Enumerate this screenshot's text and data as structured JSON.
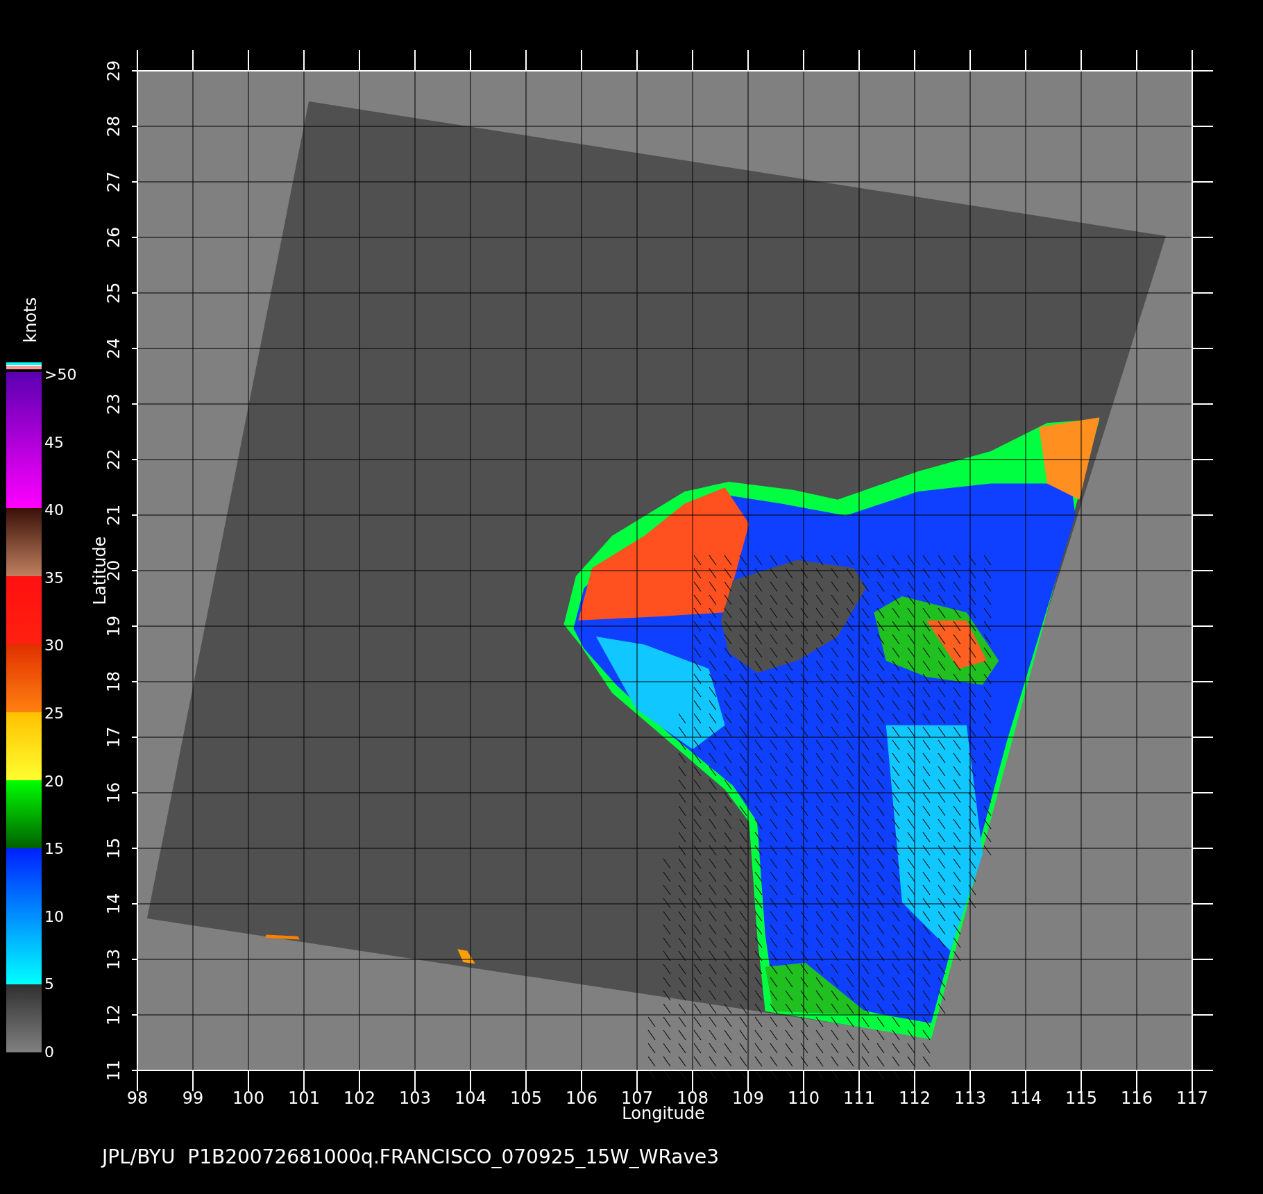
{
  "colorbar": {
    "unit": "knots",
    "labels": [
      ">50",
      "45",
      "40",
      "35",
      "30",
      "25",
      "20",
      "15",
      "10",
      "5",
      "0"
    ]
  },
  "map": {
    "xlabel": "Longitude",
    "ylabel": "Latitude",
    "xticks": [
      "98",
      "99",
      "100",
      "101",
      "102",
      "103",
      "104",
      "105",
      "106",
      "107",
      "108",
      "109",
      "110",
      "111",
      "112",
      "113",
      "114",
      "115",
      "116",
      "117"
    ],
    "yticks": [
      "11",
      "12",
      "13",
      "14",
      "15",
      "16",
      "17",
      "18",
      "19",
      "20",
      "21",
      "22",
      "23",
      "24",
      "25",
      "26",
      "27",
      "28",
      "29"
    ]
  },
  "caption": "JPL/BYU  P1B20072681000q.FRANCISCO_070925_15W_WRave3"
}
